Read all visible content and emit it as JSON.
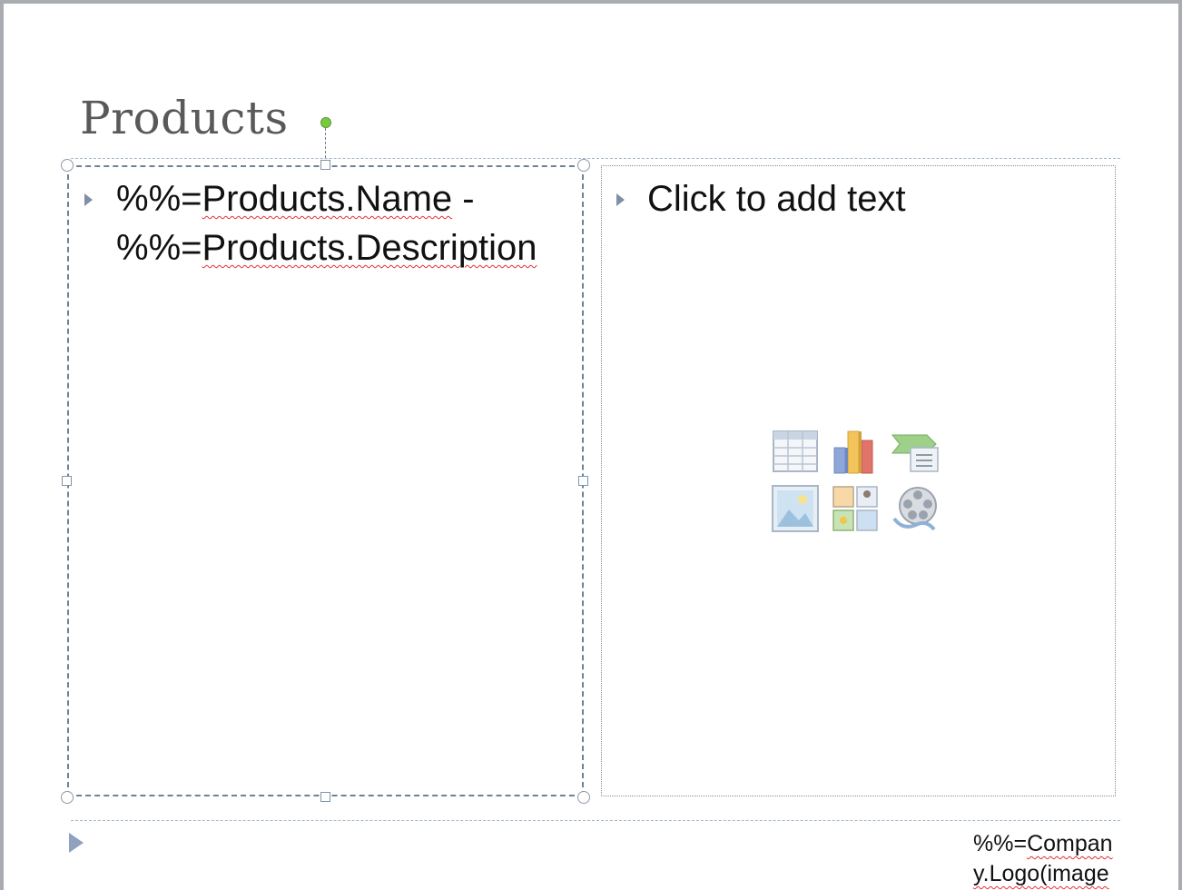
{
  "slide": {
    "title": "Products",
    "left_placeholder": {
      "line1_prefix": "%%=",
      "line1_field": "Products.Name",
      "line1_suffix": " -",
      "line2_prefix": "%%=",
      "line2_field": "Products.Description"
    },
    "right_placeholder": {
      "prompt": "Click to add text",
      "insert_icons": [
        "insert-table-icon",
        "insert-chart-icon",
        "insert-smartart-icon",
        "insert-picture-icon",
        "insert-clip-art-icon",
        "insert-media-icon"
      ]
    },
    "footer": {
      "line1_prefix": "%%=",
      "line1_field": "Compan",
      "line2": "y.Logo(image"
    }
  },
  "colors": {
    "frame": "#a9adb2",
    "selection_border": "#6f8195",
    "bullet": "#7f8fa6",
    "rotation_handle": "#7ac943",
    "spell_error": "#e0303a"
  }
}
